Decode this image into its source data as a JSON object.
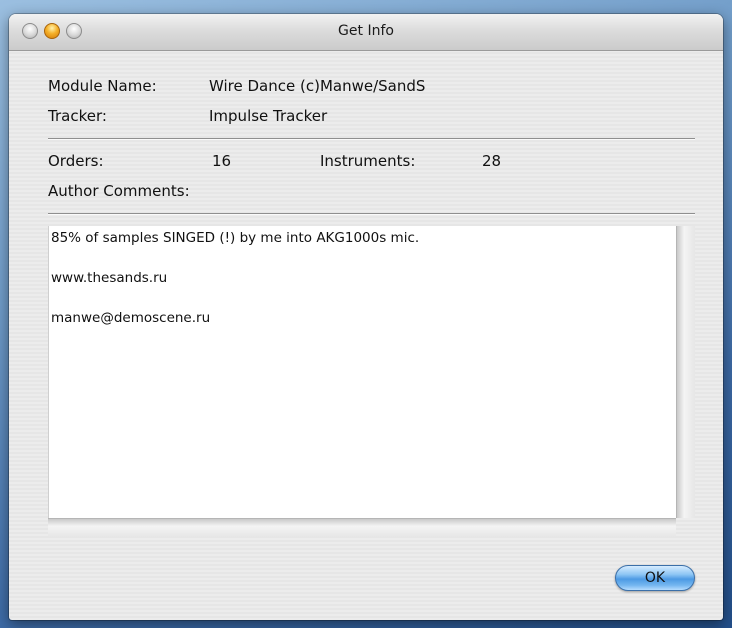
{
  "window": {
    "title": "Get Info"
  },
  "info": {
    "module_name_label": "Module Name:",
    "module_name_value": "Wire Dance (c)Manwe/SandS",
    "tracker_label": "Tracker:",
    "tracker_value": "Impulse Tracker",
    "orders_label": "Orders:",
    "orders_value": "16",
    "instruments_label": "Instruments:",
    "instruments_value": "28",
    "author_comments_label": "Author Comments:"
  },
  "comments": [
    "85% of samples SINGED (!) by me into AKG1000s mic.",
    "www.thesands.ru",
    "manwe@demoscene.ru"
  ],
  "buttons": {
    "ok_label": "OK"
  },
  "icons": {
    "close": "close-button",
    "minimize": "minimize-button",
    "zoom": "zoom-button"
  },
  "colors": {
    "ok_button_accent": "#4d9ae4",
    "minimize_button": "#f5b12a"
  }
}
